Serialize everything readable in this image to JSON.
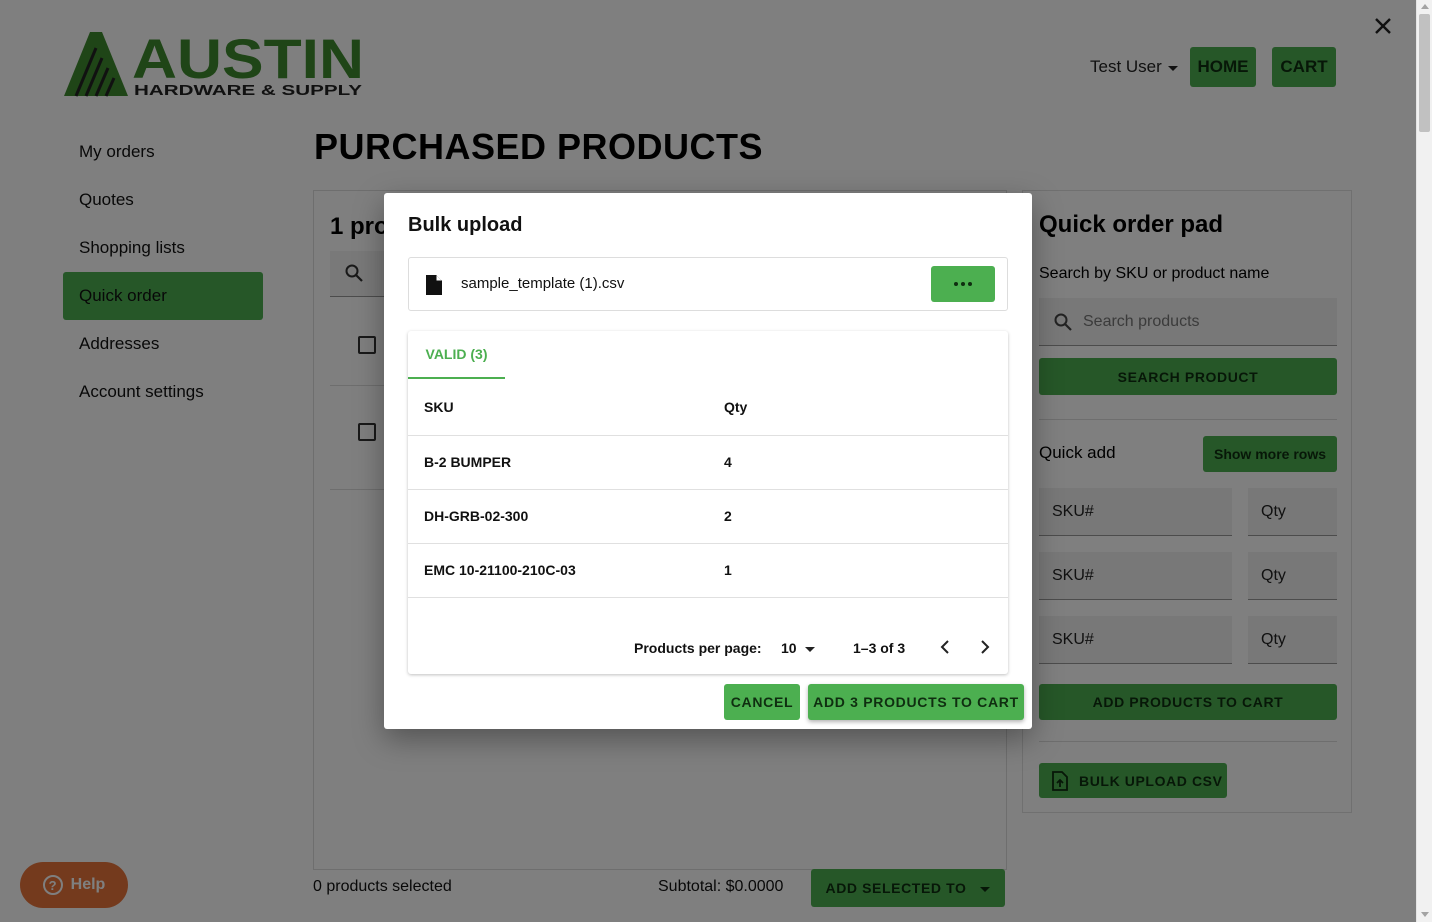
{
  "brand": {
    "name": "AUSTIN",
    "tagline": "HARDWARE & SUPPLY",
    "color": "#3f8a2f"
  },
  "header": {
    "user": "Test User",
    "home_label": "HOME",
    "cart_label": "CART"
  },
  "nav": {
    "items": [
      {
        "label": "My orders"
      },
      {
        "label": "Quotes"
      },
      {
        "label": "Shopping lists"
      },
      {
        "label": "Quick order",
        "active": true
      },
      {
        "label": "Addresses"
      },
      {
        "label": "Account settings"
      }
    ]
  },
  "page": {
    "title": "PURCHASED PRODUCTS",
    "product_count": "1 pro"
  },
  "quick_order_pad": {
    "title": "Quick order pad",
    "search_label": "Search by SKU or product name",
    "search_placeholder": "Search products",
    "search_button": "SEARCH PRODUCT",
    "quick_add_label": "Quick add",
    "show_more_rows": "Show more rows",
    "rows": [
      {
        "sku_placeholder": "SKU#",
        "qty_placeholder": "Qty"
      },
      {
        "sku_placeholder": "SKU#",
        "qty_placeholder": "Qty"
      },
      {
        "sku_placeholder": "SKU#",
        "qty_placeholder": "Qty"
      }
    ],
    "add_to_cart": "ADD PRODUCTS TO CART",
    "bulk_upload": "BULK UPLOAD CSV"
  },
  "footer_bar": {
    "selected": "0 products selected",
    "subtotal": "Subtotal: $0.0000",
    "add_selected": "ADD SELECTED TO"
  },
  "help": {
    "label": "Help"
  },
  "dialog": {
    "title": "Bulk upload",
    "file_name": "sample_template (1).csv",
    "tab_valid": "VALID (3)",
    "columns": {
      "sku": "SKU",
      "qty": "Qty"
    },
    "rows": [
      {
        "sku": "B-2 BUMPER",
        "qty": "4"
      },
      {
        "sku": "DH-GRB-02-300",
        "qty": "2"
      },
      {
        "sku": "EMC 10-21100-210C-03",
        "qty": "1"
      }
    ],
    "pager": {
      "label": "Products per page:",
      "per_page": "10",
      "range": "1–3 of 3"
    },
    "cancel": "CANCEL",
    "add": "ADD 3 PRODUCTS TO CART"
  },
  "colors": {
    "accent": "#4caf50",
    "help": "#e8743b",
    "overlay": "rgba(0,0,0,0.5)"
  }
}
